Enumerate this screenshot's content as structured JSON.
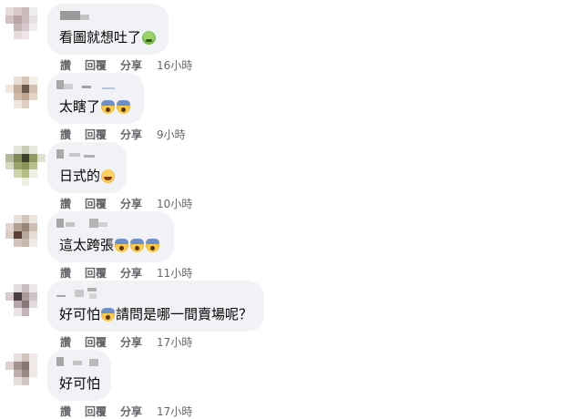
{
  "actions": {
    "read": "讚",
    "reply": "回覆",
    "share": "分享"
  },
  "comments": [
    {
      "text_parts": [
        "看圖就想吐了"
      ],
      "emojis": [
        "nausea-emoji"
      ],
      "time": "16小時"
    },
    {
      "text_parts": [
        "太瞎了"
      ],
      "emojis": [
        "scream-emoji",
        "scream-emoji"
      ],
      "time": "9小時"
    },
    {
      "text_parts": [
        "日式的"
      ],
      "emojis": [
        "laugh-emoji"
      ],
      "time": "10小時"
    },
    {
      "text_parts": [
        "這太跨張"
      ],
      "emojis": [
        "scream-emoji",
        "scream-emoji",
        "scream-emoji"
      ],
      "time": "11小時"
    },
    {
      "text_parts": [
        "好可怕",
        "請問是哪一間賣場呢？"
      ],
      "emojis": [
        "scream-emoji"
      ],
      "time": "17小時"
    },
    {
      "text_parts": [
        "好可怕"
      ],
      "emojis": [],
      "time": "17小時"
    }
  ],
  "colors": {
    "bubble": "#f0f2f5",
    "action_text": "#65676b",
    "body_text": "#050505"
  }
}
